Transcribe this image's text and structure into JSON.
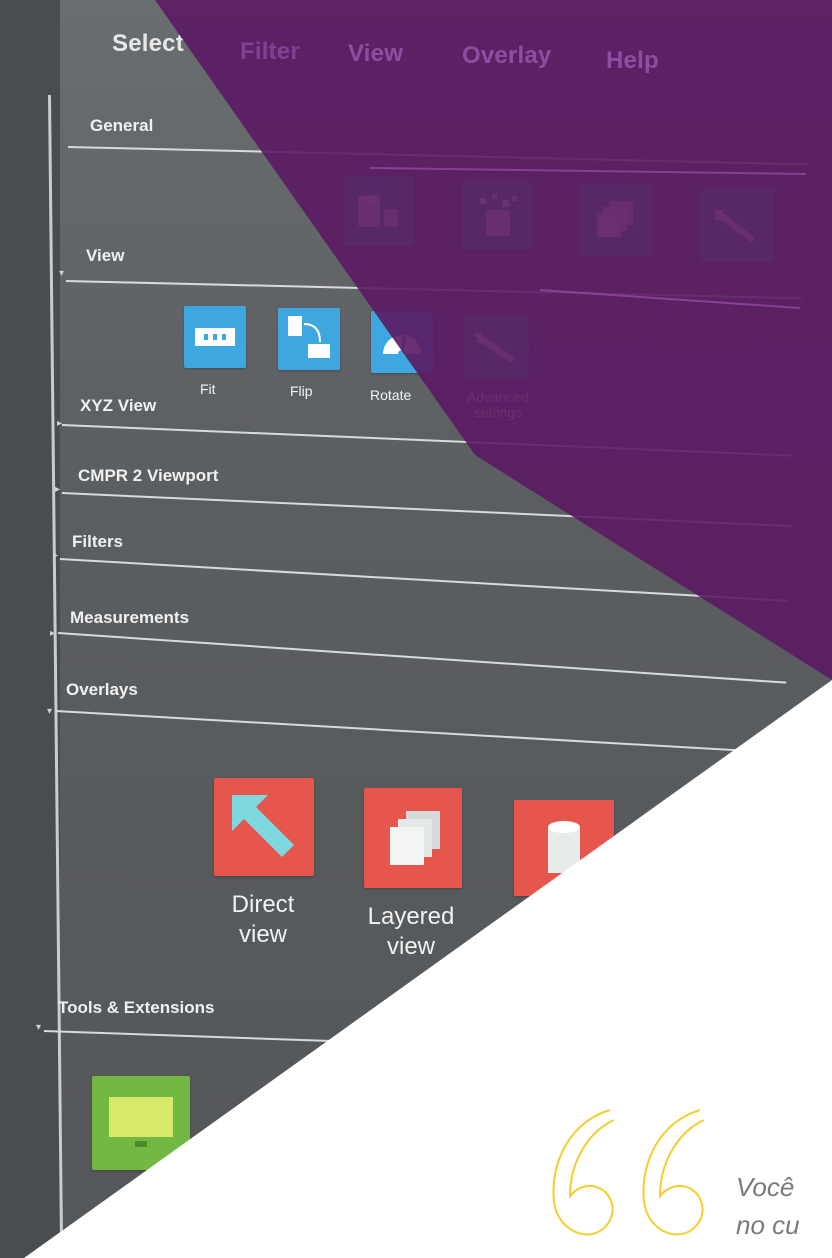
{
  "menubar": {
    "items": [
      {
        "label": "Select"
      },
      {
        "label": "Filter"
      },
      {
        "label": "View"
      },
      {
        "label": "Overlay"
      },
      {
        "label": "Help"
      }
    ]
  },
  "sections": {
    "general": {
      "title": "General"
    },
    "view": {
      "title": "View",
      "tools": [
        {
          "label": "Fit",
          "icon": "fit-icon",
          "color": "#3fa7e0"
        },
        {
          "label": "Flip",
          "icon": "flip-icon",
          "color": "#3fa7e0"
        },
        {
          "label": "Rotate",
          "icon": "rotate-icon",
          "color": "#3fa7e0"
        },
        {
          "label_line1": "Advanced",
          "label_line2": "settings",
          "icon": "advanced-settings-icon",
          "color": "#3aa688"
        }
      ]
    },
    "xyz_view": {
      "title": "XYZ View"
    },
    "cmpr_viewport": {
      "title": "CMPR 2 Viewport"
    },
    "filters": {
      "title": "Filters"
    },
    "measurements": {
      "title": "Measurements"
    },
    "overlays": {
      "title": "Overlays",
      "tools": [
        {
          "line1": "Direct",
          "line2": "view",
          "icon": "direct-view-icon",
          "color": "#e6564c"
        },
        {
          "line1": "Layered",
          "line2": "view",
          "icon": "layered-view-icon",
          "color": "#e6564c"
        },
        {
          "icon": "cylinder-icon",
          "color": "#e6564c"
        }
      ]
    },
    "tools_extensions": {
      "title": "Tools & Extensions"
    }
  },
  "general_tools": [
    {
      "icon": "volume-icon",
      "color": "#3aa688"
    },
    {
      "icon": "segmentation-icon",
      "color": "#3aa688"
    },
    {
      "icon": "stack-icon",
      "color": "#3aa688"
    },
    {
      "icon": "probe-icon",
      "color": "#3aa688"
    }
  ],
  "quote": {
    "line1": "Você",
    "line2": "no cu"
  },
  "colors": {
    "purple_overlay": "#5b1a63",
    "accent_yellow": "#f2cf2c",
    "background_white": "#ffffff"
  }
}
